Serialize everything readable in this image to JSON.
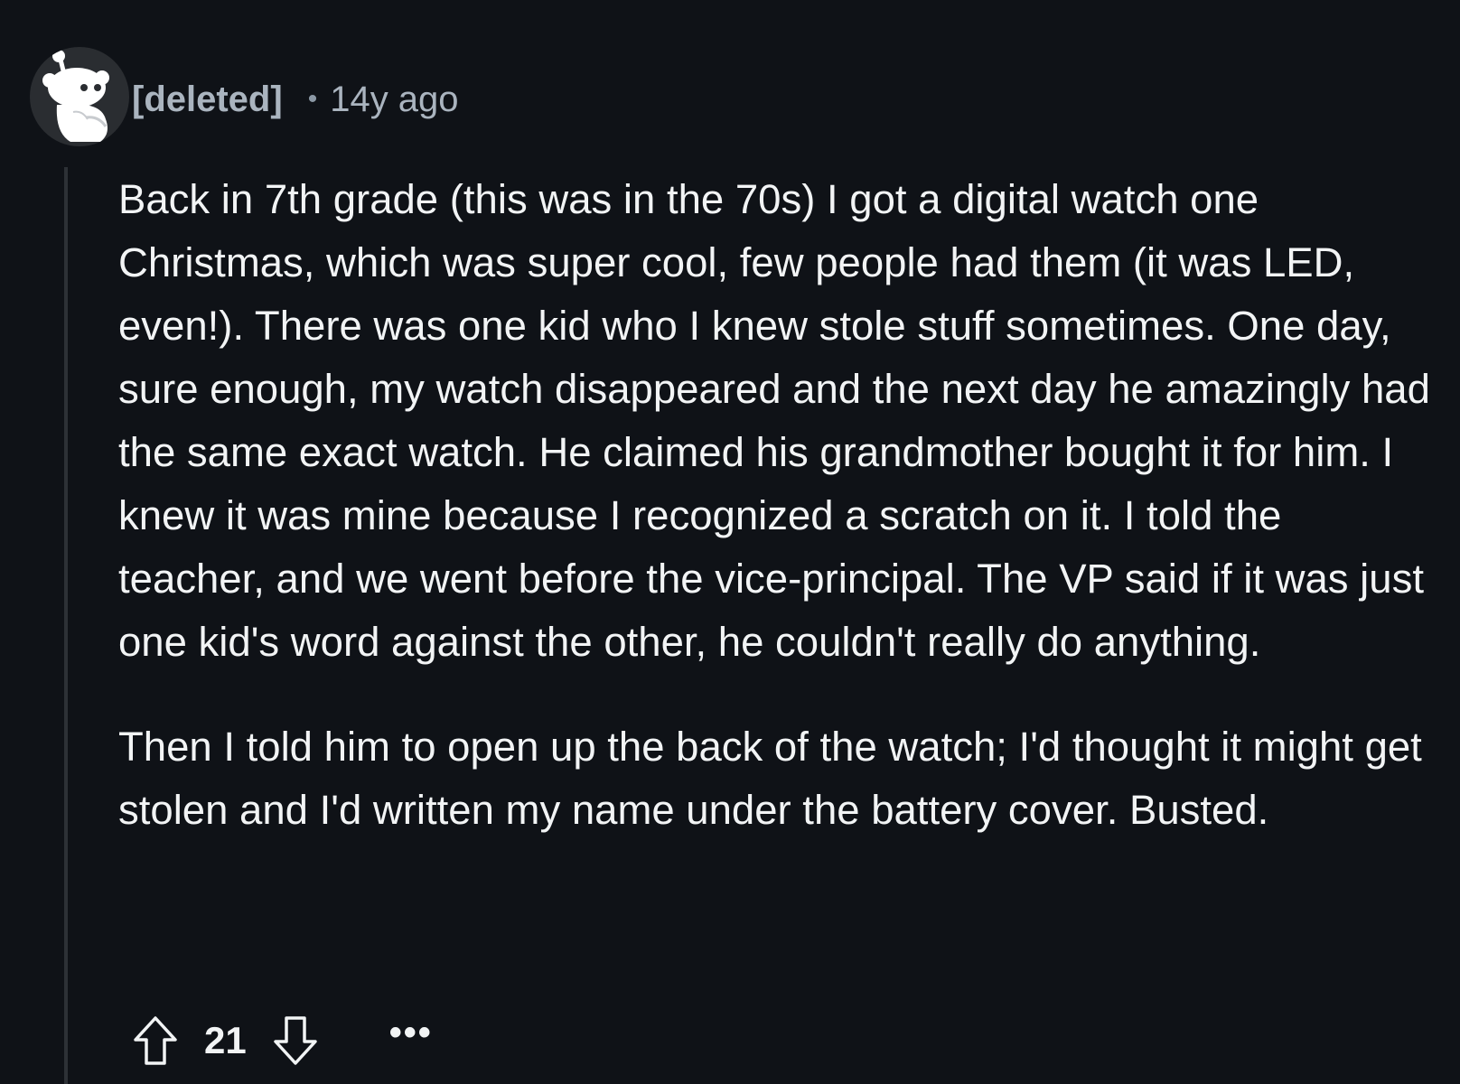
{
  "comment": {
    "author": "[deleted]",
    "separator": "•",
    "age": "14y ago",
    "avatar_icon": "snoo-avatar-icon",
    "paragraphs": [
      "Back in 7th grade (this was in the 70s) I got a digital watch one Christmas, which was super cool, few people had them (it was LED, even!). There was one kid who I knew stole stuff sometimes. One day, sure enough, my watch disappeared and the next day he amazingly had the same exact watch. He claimed his grandmother bought it for him. I knew it was mine because I recognized a scratch on it. I told the teacher, and we went before the vice-principal. The VP said if it was just one kid's word against the other, he couldn't really do anything.",
      "Then I told him to open up the back of the watch; I'd thought it might get stolen and I'd written my name under the battery cover. Busted."
    ],
    "score": "21",
    "more_label": "•••",
    "upvote_icon": "arrow-up-icon",
    "downvote_icon": "arrow-down-icon"
  },
  "colors": {
    "background": "#0f1217",
    "text": "#f2f4f5",
    "meta": "#aab4bf",
    "thread_line": "#2d3136"
  }
}
